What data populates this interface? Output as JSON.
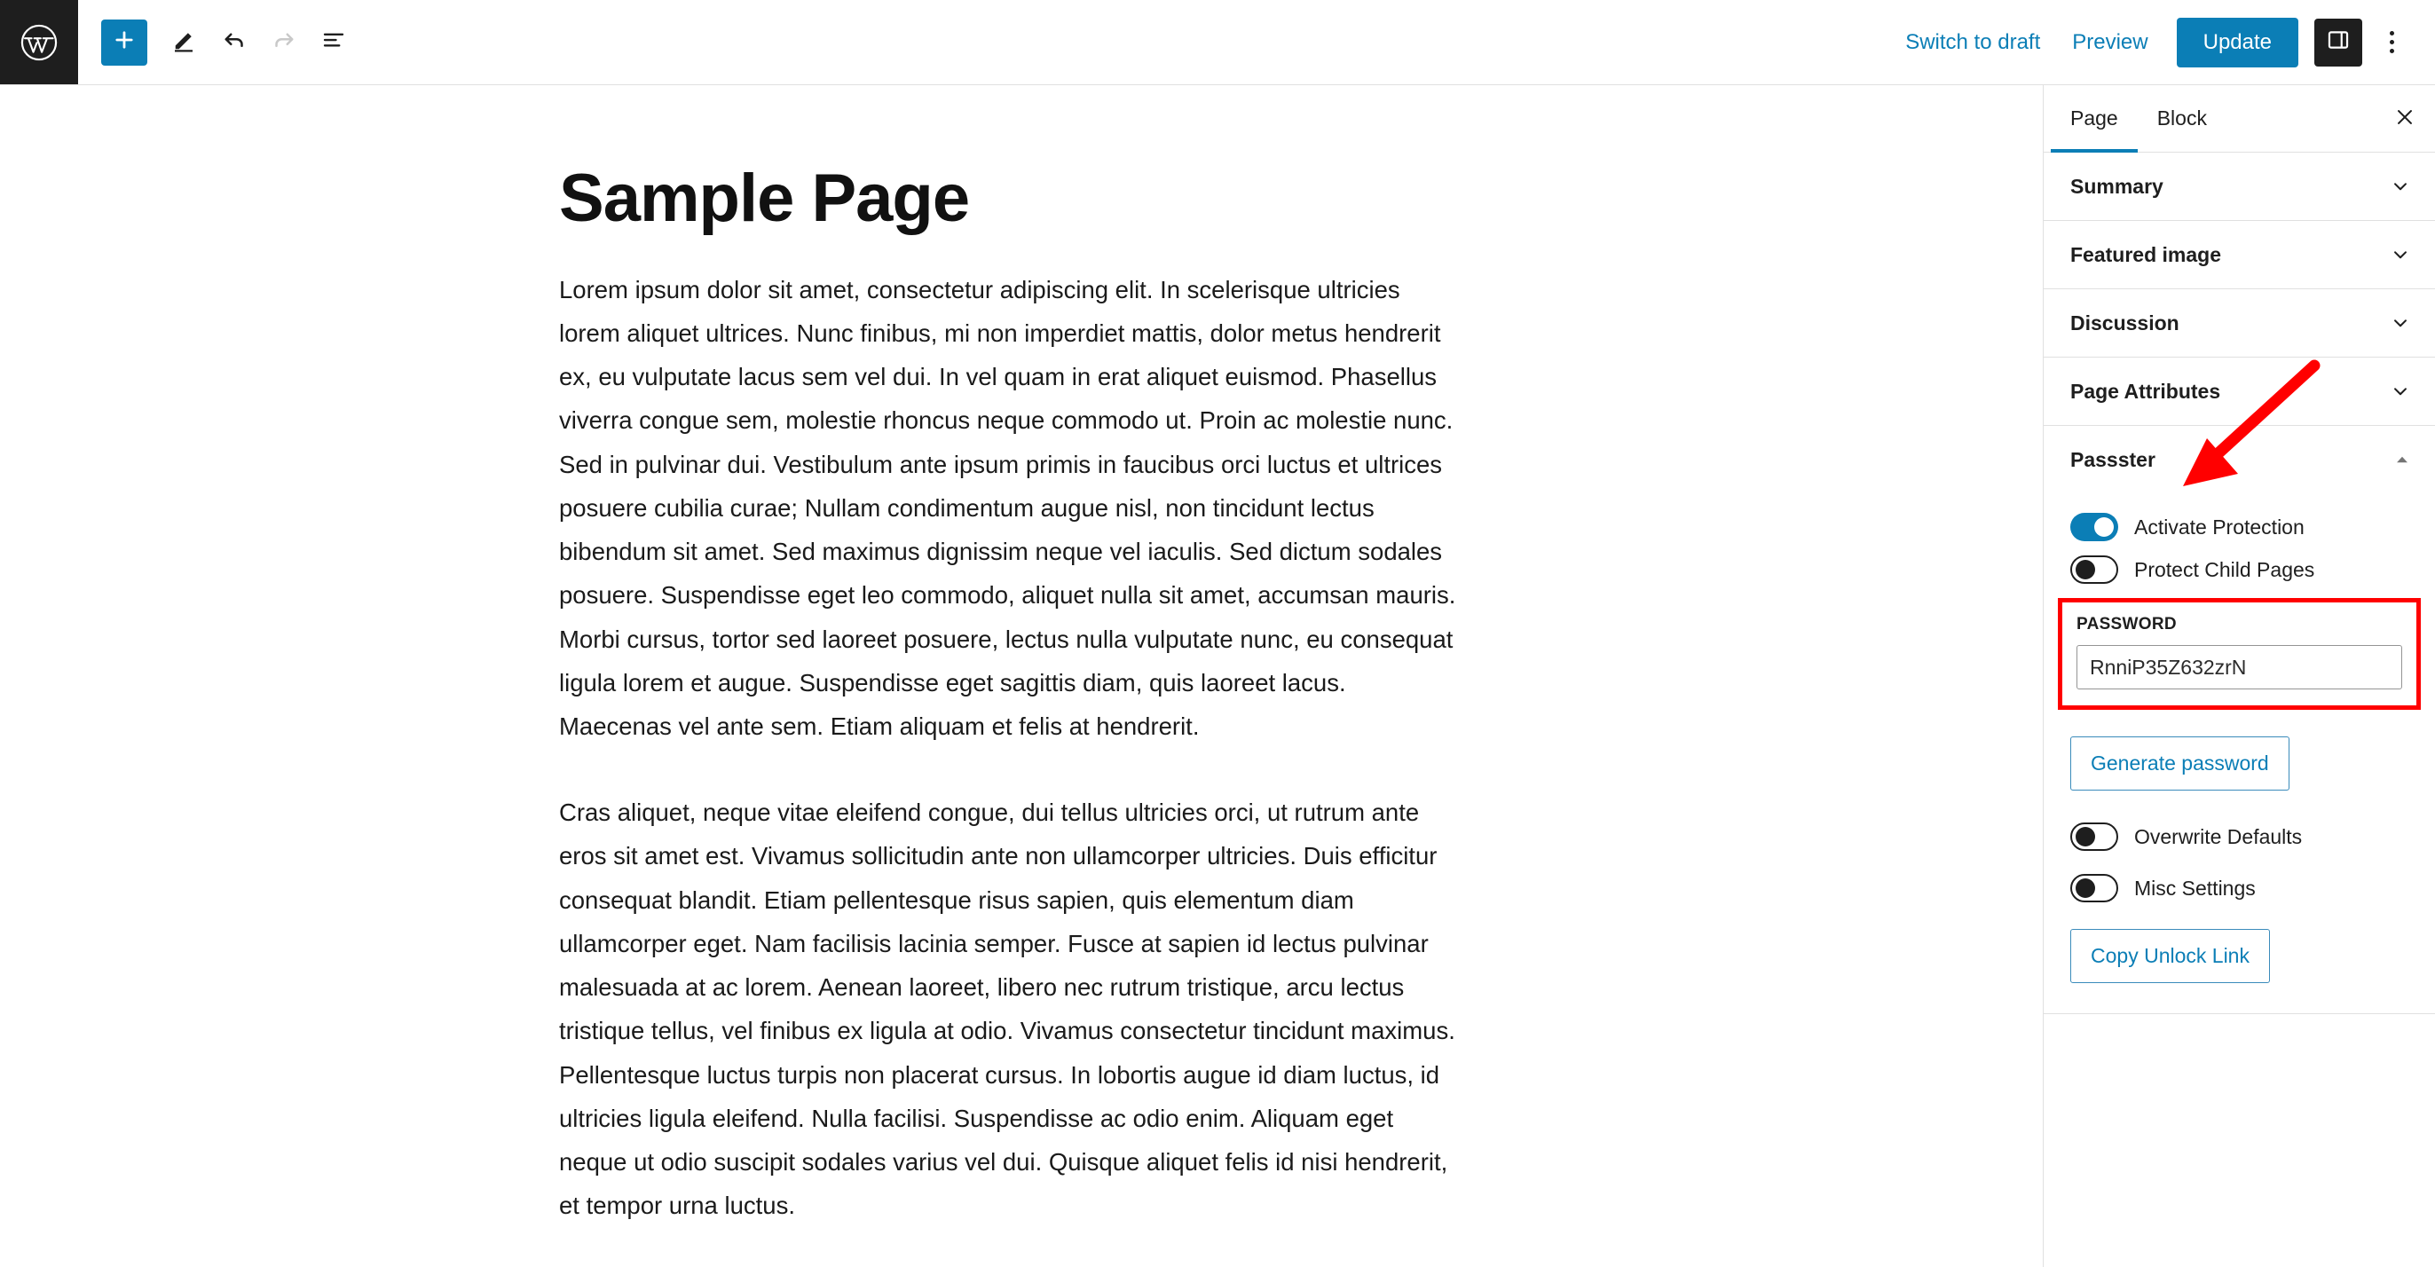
{
  "toolbar": {
    "logo_icon": "wordpress-logo-icon",
    "add_block_icon": "plus-icon",
    "edit_tool_icon": "pencil-icon",
    "undo_icon": "undo-arrow-icon",
    "redo_icon": "redo-arrow-icon",
    "list_view_icon": "document-overview-icon",
    "switch_to_draft_label": "Switch to draft",
    "preview_label": "Preview",
    "update_label": "Update",
    "sidebar_toggle_icon": "settings-sidebar-icon",
    "more_options_icon": "three-dots-vertical-icon"
  },
  "editor": {
    "title": "Sample Page",
    "paragraphs": [
      "Lorem ipsum dolor sit amet, consectetur adipiscing elit. In scelerisque ultricies lorem aliquet ultrices. Nunc finibus, mi non imperdiet mattis, dolor metus hendrerit ex, eu vulputate lacus sem vel dui. In vel quam in erat aliquet euismod. Phasellus viverra congue sem, molestie rhoncus neque commodo ut. Proin ac molestie nunc. Sed in pulvinar dui. Vestibulum ante ipsum primis in faucibus orci luctus et ultrices posuere cubilia curae; Nullam condimentum augue nisl, non tincidunt lectus bibendum sit amet. Sed maximus dignissim neque vel iaculis. Sed dictum sodales posuere. Suspendisse eget leo commodo, aliquet nulla sit amet, accumsan mauris. Morbi cursus, tortor sed laoreet posuere, lectus nulla vulputate nunc, eu consequat ligula lorem et augue. Suspendisse eget sagittis diam, quis laoreet lacus. Maecenas vel ante sem. Etiam aliquam et felis at hendrerit.",
      "Cras aliquet, neque vitae eleifend congue, dui tellus ultricies orci, ut rutrum ante eros sit amet est. Vivamus sollicitudin ante non ullamcorper ultricies. Duis efficitur consequat blandit. Etiam pellentesque risus sapien, quis elementum diam ullamcorper eget. Nam facilisis lacinia semper. Fusce at sapien id lectus pulvinar malesuada at ac lorem. Aenean laoreet, libero nec rutrum tristique, arcu lectus tristique tellus, vel finibus ex ligula at odio. Vivamus consectetur tincidunt maximus. Pellentesque luctus turpis non placerat cursus. In lobortis augue id diam luctus, id ultricies ligula eleifend. Nulla facilisi. Suspendisse ac odio enim. Aliquam eget neque ut odio suscipit sodales varius vel dui. Quisque aliquet felis id nisi hendrerit, et tempor urna luctus."
    ]
  },
  "sidebar": {
    "tabs": [
      {
        "label": "Page",
        "active": true
      },
      {
        "label": "Block",
        "active": false
      }
    ],
    "close_icon": "close-x-icon",
    "panels": [
      {
        "title": "Summary",
        "expanded": false,
        "chevron": "chevron-down-icon"
      },
      {
        "title": "Featured image",
        "expanded": false,
        "chevron": "chevron-down-icon"
      },
      {
        "title": "Discussion",
        "expanded": false,
        "chevron": "chevron-down-icon"
      },
      {
        "title": "Page Attributes",
        "expanded": false,
        "chevron": "chevron-down-icon"
      }
    ],
    "passster": {
      "title": "Passster",
      "chevron": "chevron-up-icon",
      "expanded": true,
      "toggles": [
        {
          "label": "Activate Protection",
          "on": true
        },
        {
          "label": "Protect Child Pages",
          "on": false
        }
      ],
      "password_label": "PASSWORD",
      "password_value": "RnniP35Z632zrN",
      "generate_password_label": "Generate password",
      "toggles_lower": [
        {
          "label": "Overwrite Defaults",
          "on": false
        },
        {
          "label": "Misc Settings",
          "on": false
        }
      ],
      "copy_unlock_link_label": "Copy Unlock Link"
    }
  },
  "annotations": {
    "arrow_icon": "red-arrow-pointing-down-left",
    "highlight_box_icon": "red-highlight-rectangle"
  },
  "colors": {
    "accent_blue": "#0b7eb6",
    "annotation_red": "#ff0000",
    "dark": "#1e1e1e",
    "border": "#e0e0e0"
  }
}
